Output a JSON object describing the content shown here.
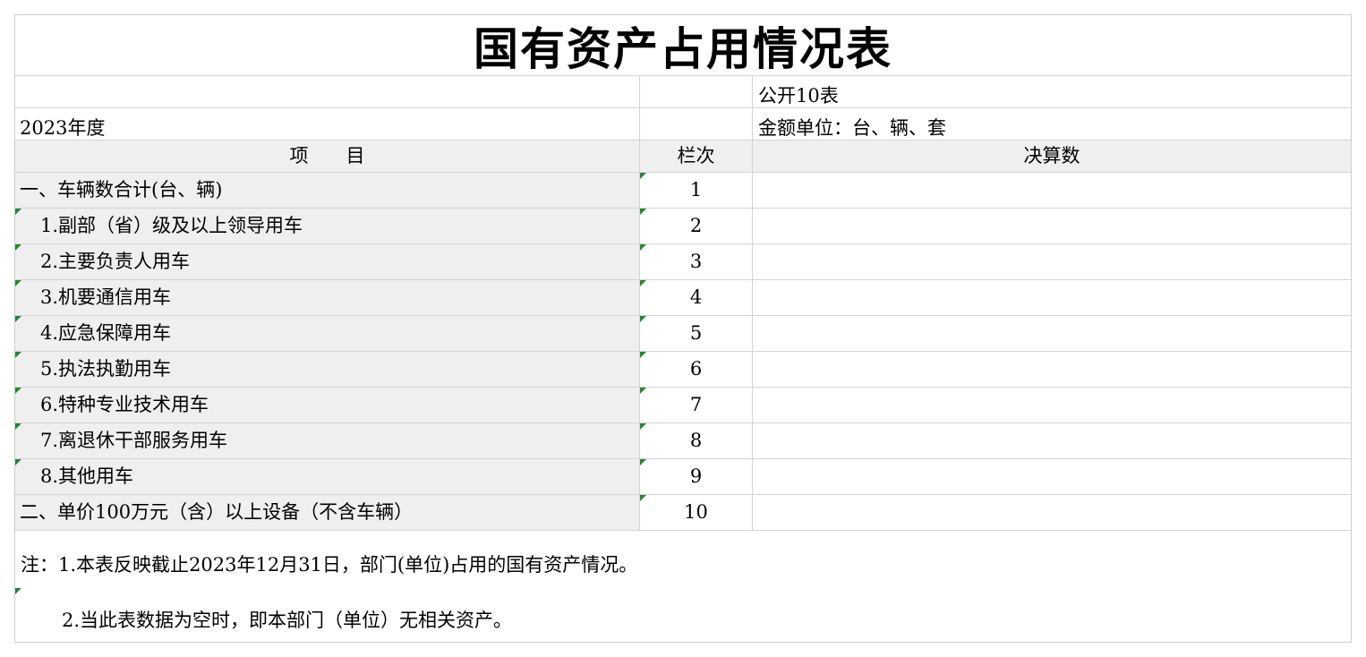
{
  "title": "国有资产占用情况表",
  "meta": {
    "table_no": "公开10表",
    "year": "2023年度",
    "unit": "金额单位：台、辆、套"
  },
  "headers": {
    "item": "项　　目",
    "col_no": "栏次",
    "amount": "决算数"
  },
  "rows": [
    {
      "item": "一、车辆数合计(台、辆)",
      "col_no": "1",
      "amount": ""
    },
    {
      "item": "1.副部（省）级及以上领导用车",
      "col_no": "2",
      "amount": ""
    },
    {
      "item": "2.主要负责人用车",
      "col_no": "3",
      "amount": ""
    },
    {
      "item": "3.机要通信用车",
      "col_no": "4",
      "amount": ""
    },
    {
      "item": "4.应急保障用车",
      "col_no": "5",
      "amount": ""
    },
    {
      "item": "5.执法执勤用车",
      "col_no": "6",
      "amount": ""
    },
    {
      "item": "6.特种专业技术用车",
      "col_no": "7",
      "amount": ""
    },
    {
      "item": "7.离退休干部服务用车",
      "col_no": "8",
      "amount": ""
    },
    {
      "item": "8.其他用车",
      "col_no": "9",
      "amount": ""
    },
    {
      "item": "二、单价100万元（含）以上设备（不含车辆）",
      "col_no": "10",
      "amount": ""
    }
  ],
  "notes": {
    "line1": "注：1.本表反映截止2023年12月31日，部门(单位)占用的国有资产情况。",
    "line2": "2.当此表数据为空时，即本部门（单位）无相关资产。"
  },
  "colors": {
    "grid": "#d4d4d4",
    "shaded_cell": "#efefef",
    "comment_marker": "#1e8a2c"
  }
}
